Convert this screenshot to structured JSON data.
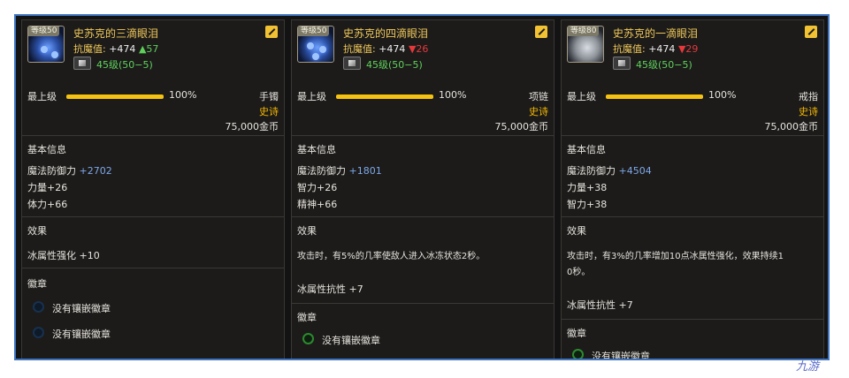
{
  "cards": [
    {
      "level": "等级50",
      "name": "史苏克的三滴眼泪",
      "resist_label": "抗魔值:",
      "resist_value": "+474",
      "resist_change": "▲57",
      "grade": "45级(50−5)",
      "upgrade_label": "最上级",
      "upgrade_percent": "100%",
      "slot": "手镯",
      "rarity": "史诗",
      "price": "75,000金币",
      "basic_title": "基本信息",
      "stat1_label": "魔法防御力",
      "stat1_value": "+2702",
      "stat2": "力量+26",
      "stat3": "体力+66",
      "effect_title": "效果",
      "effect_text": "冰属性强化 +10",
      "emblem_title": "徽章",
      "emblem1": "没有镶嵌徽章",
      "emblem2": "没有镶嵌徽章"
    },
    {
      "level": "等级50",
      "name": "史苏克的四滴眼泪",
      "resist_label": "抗魔值:",
      "resist_value": "+474",
      "resist_change": "▼26",
      "grade": "45级(50−5)",
      "upgrade_label": "最上级",
      "upgrade_percent": "100%",
      "slot": "项链",
      "rarity": "史诗",
      "price": "75,000金币",
      "basic_title": "基本信息",
      "stat1_label": "魔法防御力",
      "stat1_value": "+1801",
      "stat2": "智力+26",
      "stat3": "精神+66",
      "effect_title": "效果",
      "effect_text": "攻击时，有5%的几率使敌人进入冰冻状态2秒。",
      "effect_text2": "冰属性抗性 +7",
      "emblem_title": "徽章",
      "emblem1": "没有镶嵌徽章"
    },
    {
      "level": "等级80",
      "name": "史苏克的一滴眼泪",
      "resist_label": "抗魔值:",
      "resist_value": "+474",
      "resist_change": "▼29",
      "grade": "45级(50−5)",
      "upgrade_label": "最上级",
      "upgrade_percent": "100%",
      "slot": "戒指",
      "rarity": "史诗",
      "price": "75,000金币",
      "basic_title": "基本信息",
      "stat1_label": "魔法防御力",
      "stat1_value": "+4504",
      "stat2": "力量+38",
      "stat3": "智力+38",
      "effect_title": "效果",
      "effect_text_line1": "攻击时，有3%的几率增加10点冰属性强化，效果持续1",
      "effect_text_line2": "0秒。",
      "effect_text2": "冰属性抗性 +7",
      "emblem_title": "徽章",
      "emblem1": "没有镶嵌徽章"
    }
  ],
  "watermark": "九游",
  "colors": {
    "frame_border": "#3f74c2",
    "name_gold": "#f0c85a",
    "up_green": "#5fd15b",
    "down_red": "#e5383b",
    "epic": "#f5b800",
    "stat_blue": "#7ea8e8"
  }
}
